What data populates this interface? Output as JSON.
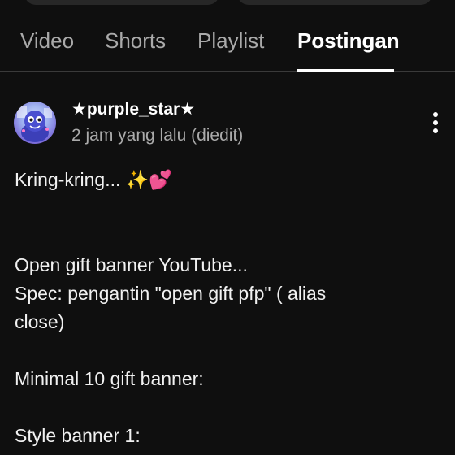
{
  "tabs": [
    {
      "label": "Video",
      "active": false
    },
    {
      "label": "Shorts",
      "active": false
    },
    {
      "label": "Playlist",
      "active": false
    },
    {
      "label": "Postingan",
      "active": true
    }
  ],
  "post": {
    "author": "★purple_star★",
    "timestamp": "2 jam yang lalu (diedit)",
    "lines": [
      "Kring-kring... ✨💕",
      "Open gift banner YouTube...",
      "Spec: pengantin \"open gift pfp\" ( alias",
      "close)",
      "Minimal 10 gift banner:",
      "Style banner 1:"
    ]
  },
  "icons": {
    "more": "more-vertical-icon",
    "avatar": "profile-avatar"
  },
  "colors": {
    "background": "#0f0f0f",
    "text_primary": "#f1f1f1",
    "text_secondary": "#aaaaaa",
    "divider": "#3a3a3a"
  }
}
